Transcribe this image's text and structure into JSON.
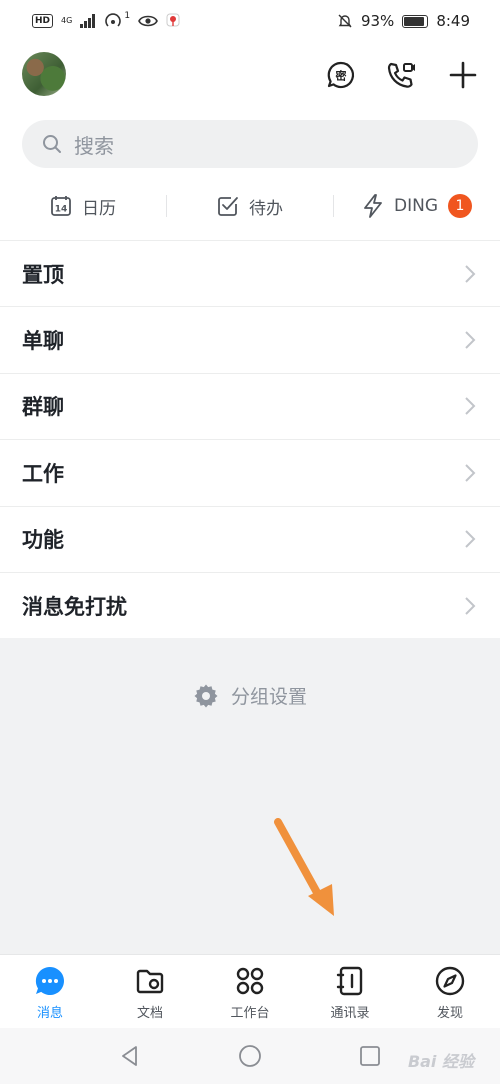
{
  "status_bar": {
    "network": "4G",
    "notification_count": "1",
    "battery": "93%",
    "time": "8:49"
  },
  "search": {
    "placeholder": "搜索"
  },
  "quick_actions": [
    {
      "label": "日历",
      "icon": "calendar-icon",
      "calendar_day": "14"
    },
    {
      "label": "待办",
      "icon": "checkbox-icon"
    },
    {
      "label": "DING",
      "icon": "lightning-icon",
      "badge": "1"
    }
  ],
  "groups": [
    {
      "label": "置顶"
    },
    {
      "label": "单聊"
    },
    {
      "label": "群聊"
    },
    {
      "label": "工作"
    },
    {
      "label": "功能"
    },
    {
      "label": "消息免打扰"
    }
  ],
  "group_settings_label": "分组设置",
  "tabs": [
    {
      "label": "消息",
      "icon": "message-icon",
      "active": true
    },
    {
      "label": "文档",
      "icon": "folder-icon",
      "active": false
    },
    {
      "label": "工作台",
      "icon": "apps-icon",
      "active": false
    },
    {
      "label": "通讯录",
      "icon": "contacts-icon",
      "active": false
    },
    {
      "label": "发现",
      "icon": "compass-icon",
      "active": false
    }
  ],
  "header_badge_text": "密",
  "watermark": "Bai 经验",
  "colors": {
    "accent": "#1890ff",
    "badge": "#f0561f",
    "arrow": "#f0913c",
    "gray_bg": "#f1f2f3"
  }
}
